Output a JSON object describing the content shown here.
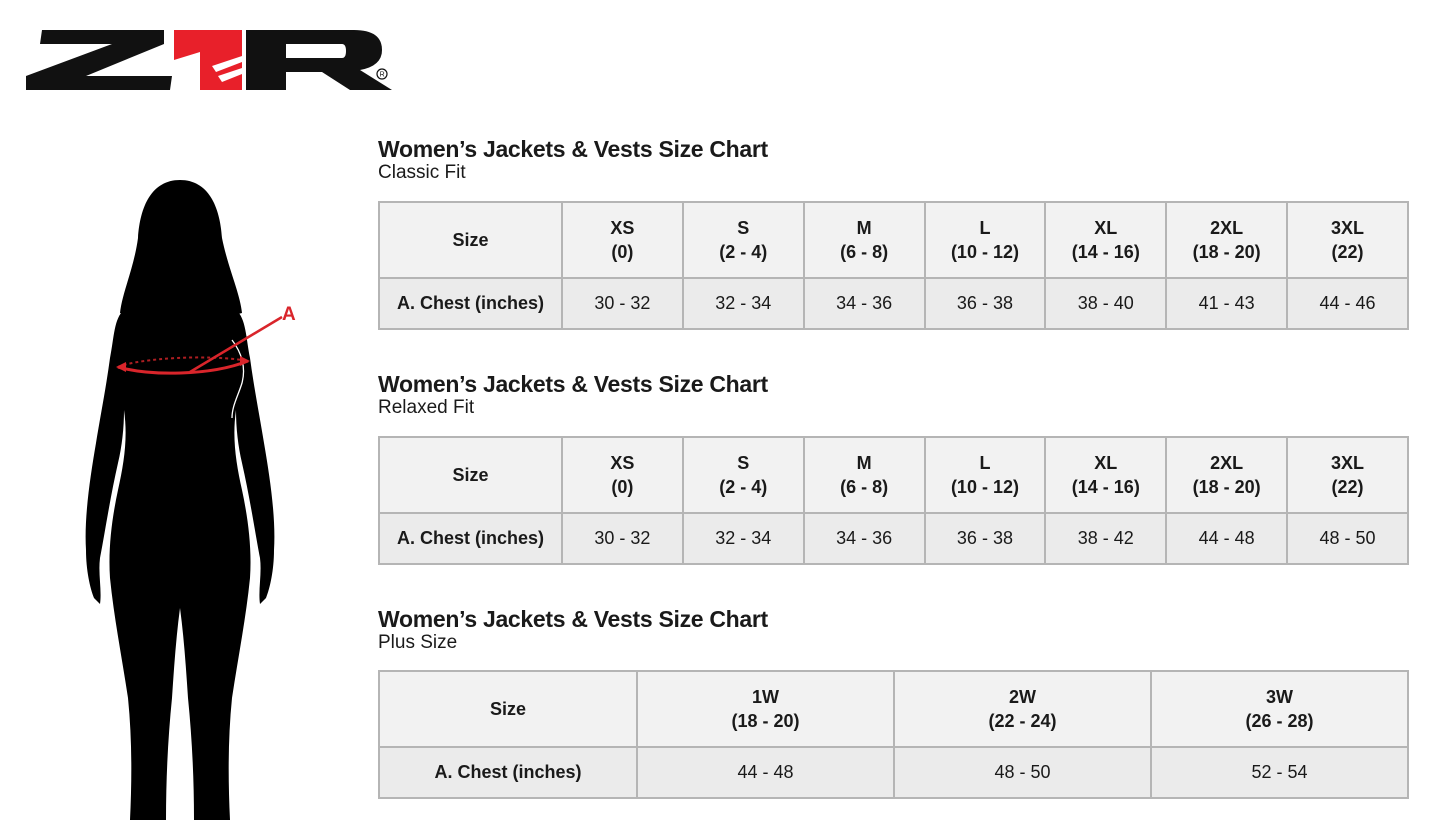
{
  "brand": {
    "name": "Z1R",
    "accent_color": "#e8202a"
  },
  "figure": {
    "measure_label": "A"
  },
  "sections": [
    {
      "title": "Women’s Jackets & Vests Size Chart",
      "subtitle": "Classic Fit",
      "size_header": "Size",
      "sizes": [
        {
          "name": "XS",
          "range": "(0)"
        },
        {
          "name": "S",
          "range": "(2 - 4)"
        },
        {
          "name": "M",
          "range": "(6 - 8)"
        },
        {
          "name": "L",
          "range": "(10 - 12)"
        },
        {
          "name": "XL",
          "range": "(14 - 16)"
        },
        {
          "name": "2XL",
          "range": "(18 - 20)"
        },
        {
          "name": "3XL",
          "range": "(22)"
        }
      ],
      "row_label": "A. Chest (inches)",
      "values": [
        "30 - 32",
        "32 - 34",
        "34 - 36",
        "36 - 38",
        "38 - 40",
        "41 - 43",
        "44 - 46"
      ]
    },
    {
      "title": "Women’s Jackets & Vests Size Chart",
      "subtitle": "Relaxed Fit",
      "size_header": "Size",
      "sizes": [
        {
          "name": "XS",
          "range": "(0)"
        },
        {
          "name": "S",
          "range": "(2 - 4)"
        },
        {
          "name": "M",
          "range": "(6 - 8)"
        },
        {
          "name": "L",
          "range": "(10 - 12)"
        },
        {
          "name": "XL",
          "range": "(14 - 16)"
        },
        {
          "name": "2XL",
          "range": "(18 - 20)"
        },
        {
          "name": "3XL",
          "range": "(22)"
        }
      ],
      "row_label": "A. Chest (inches)",
      "values": [
        "30 - 32",
        "32 - 34",
        "34 - 36",
        "36 - 38",
        "38 - 42",
        "44 - 48",
        "48 - 50"
      ]
    },
    {
      "title": "Women’s Jackets & Vests Size Chart",
      "subtitle": "Plus Size",
      "size_header": "Size",
      "sizes": [
        {
          "name": "1W",
          "range": "(18 - 20)"
        },
        {
          "name": "2W",
          "range": "(22 - 24)"
        },
        {
          "name": "3W",
          "range": "(26 - 28)"
        }
      ],
      "row_label": "A. Chest (inches)",
      "values": [
        "44 - 48",
        "48 - 50",
        "52 - 54"
      ]
    }
  ]
}
